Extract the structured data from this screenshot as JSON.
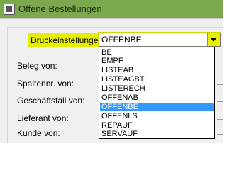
{
  "window": {
    "title": "Offene Bestellungen"
  },
  "print_settings": {
    "label": "Druckeinstellungen:",
    "selected": "OFFENBE",
    "options": [
      "BE",
      "EMPF",
      "LISTEAB",
      "LISTEAGBT",
      "LISTERECH",
      "OFFENAB",
      "OFFENBE",
      "OFFENLS",
      "REPAUF",
      "SERVAUF"
    ],
    "highlight_color": "#e6ef00",
    "selection_color": "#3399ff"
  },
  "fields": [
    {
      "label": "Beleg von:"
    },
    {
      "label": "Spaltennr. von:"
    },
    {
      "label": "Geschäftsfall von:"
    },
    {
      "label": "Lieferant von:"
    },
    {
      "label": "Kunde von:"
    }
  ],
  "theme": {
    "titlebar_color": "#7da94e"
  }
}
